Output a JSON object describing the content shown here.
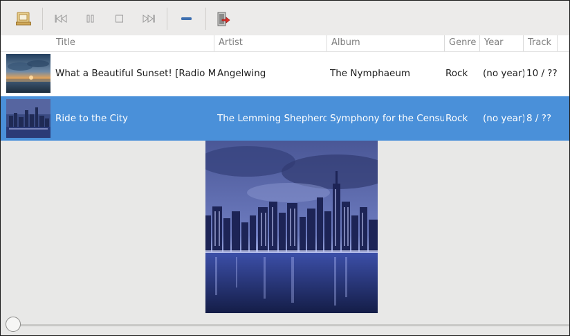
{
  "toolbar": {
    "buttons": [
      {
        "icon": "playlist-icon"
      },
      {
        "icon": "previous-track-icon"
      },
      {
        "icon": "pause-icon"
      },
      {
        "icon": "stop-icon"
      },
      {
        "icon": "next-track-icon"
      },
      {
        "icon": "volume-icon"
      },
      {
        "icon": "exit-icon"
      }
    ]
  },
  "table": {
    "columns": [
      "Title",
      "Artist",
      "Album",
      "Genre",
      "Year",
      "Track"
    ],
    "rows": [
      {
        "title": "What a Beautiful Sunset! [Radio Mix]",
        "artist": "Angelwing",
        "album": "The Nymphaeum",
        "genre": "Rock",
        "year": "(no year)",
        "track": "10 / ??",
        "selected": false,
        "thumbnail": "sunset-thumbnail"
      },
      {
        "title": "Ride to the City",
        "artist": "The Lemming Shepherds",
        "album": "Symphony for the Census",
        "genre": "Rock",
        "year": "(no year)",
        "track": "8 / ??",
        "selected": true,
        "thumbnail": "city-thumbnail"
      }
    ]
  },
  "artwork": {
    "subject": "city-skyline-at-night"
  },
  "progress": {
    "value": 0
  },
  "colors": {
    "selection": "#4a90d9",
    "toolbar_bg": "#ecebea",
    "window_bg": "#e8e8e7"
  }
}
